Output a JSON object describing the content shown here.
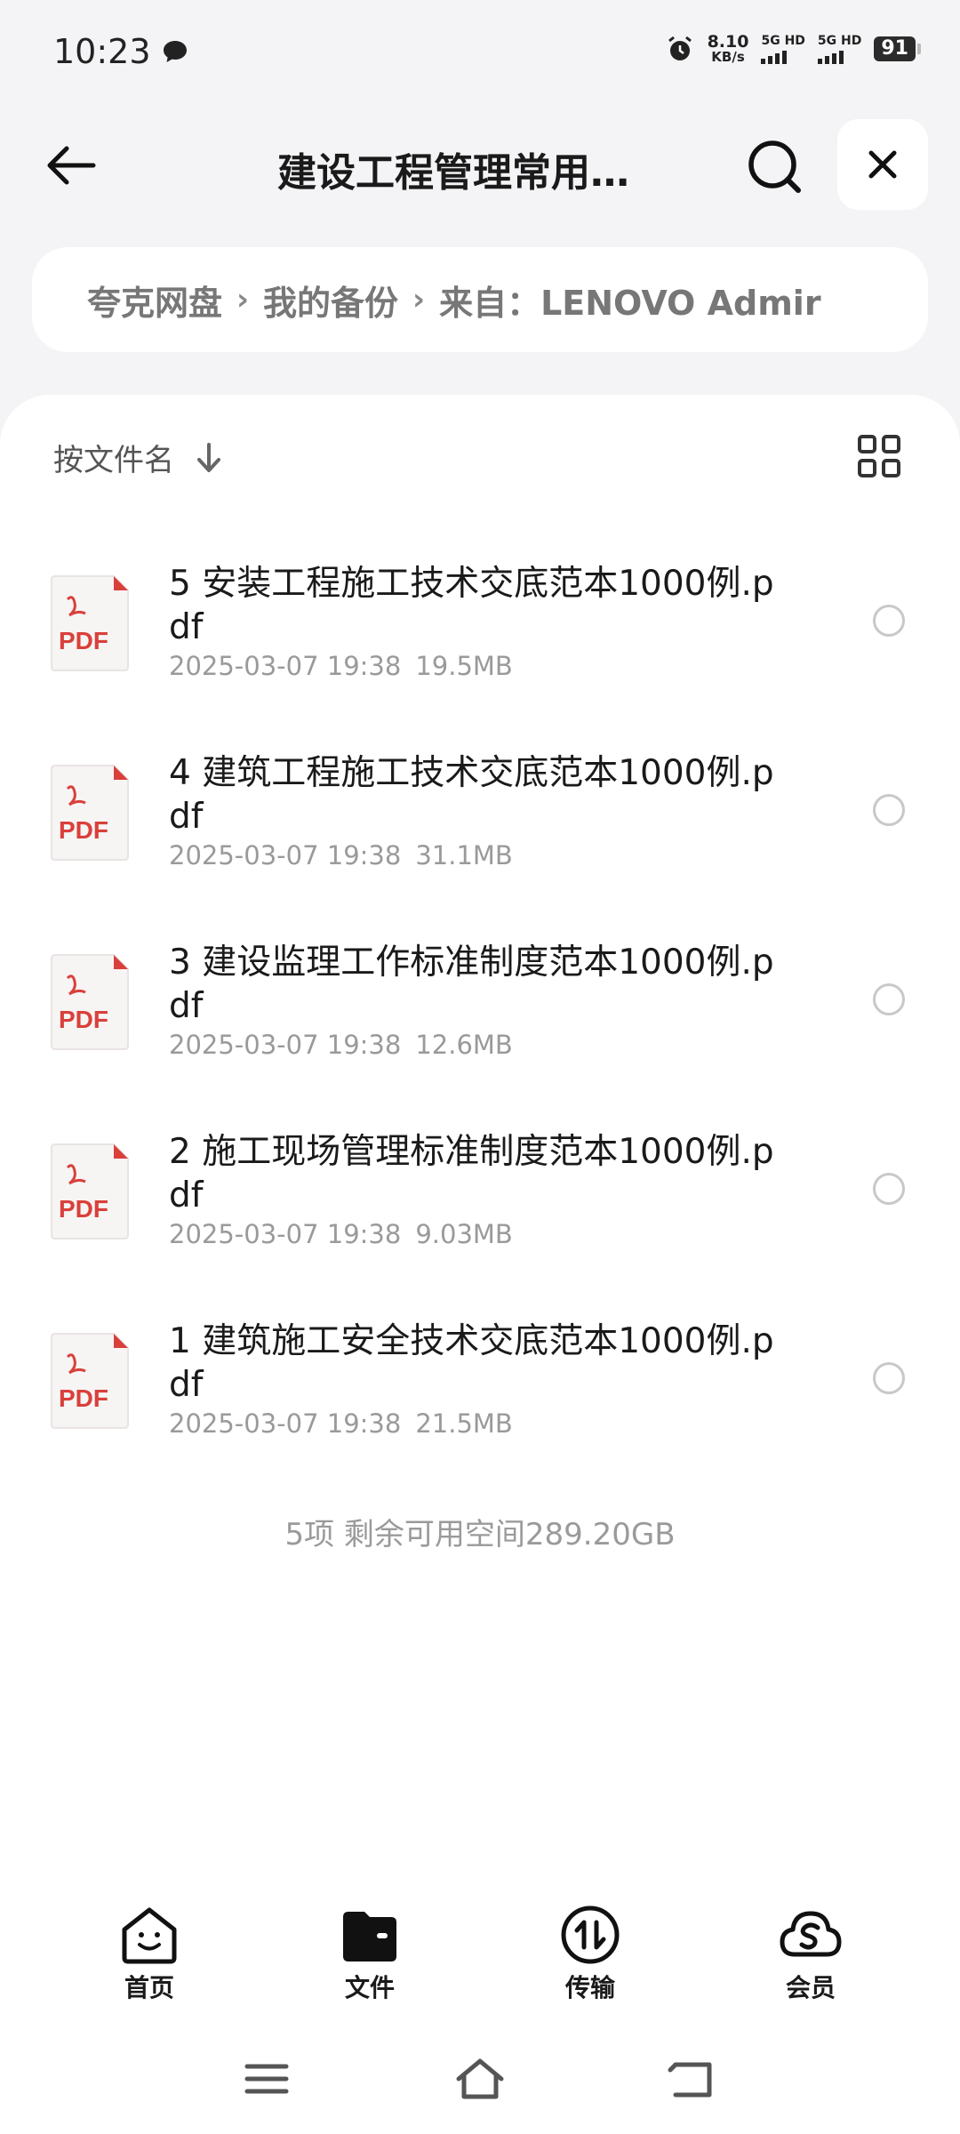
{
  "status_bar": {
    "time": "10:23",
    "net_speed_value": "8.10",
    "net_speed_unit": "KB/s",
    "sim1": "5G HD",
    "sim2": "5G HD",
    "battery": "91"
  },
  "header": {
    "title": "建设工程管理常用…",
    "back_icon": "arrow-left-icon",
    "search_icon": "search-icon",
    "close_icon": "close-icon"
  },
  "breadcrumb": [
    "夸克网盘",
    "我的备份",
    "来自：LENOVO Admir"
  ],
  "breadcrumb_separator": "›",
  "sort": {
    "label": "按文件名"
  },
  "files": [
    {
      "name": "5 安装工程施工技术交底范本1000例.pdf",
      "date": "2025-03-07 19:38",
      "size": "19.5MB"
    },
    {
      "name": "4 建筑工程施工技术交底范本1000例.pdf",
      "date": "2025-03-07 19:38",
      "size": "31.1MB"
    },
    {
      "name": "3 建设监理工作标准制度范本1000例.pdf",
      "date": "2025-03-07 19:38",
      "size": "12.6MB"
    },
    {
      "name": "2 施工现场管理标准制度范本1000例.pdf",
      "date": "2025-03-07 19:38",
      "size": "9.03MB"
    },
    {
      "name": "1 建筑施工安全技术交底范本1000例.pdf",
      "date": "2025-03-07 19:38",
      "size": "21.5MB"
    }
  ],
  "file_icon_label": "PDF",
  "summary": "5项  剩余可用空间289.20GB",
  "bottom_nav": [
    {
      "label": "首页",
      "icon": "home-smile-icon"
    },
    {
      "label": "文件",
      "icon": "folder-icon"
    },
    {
      "label": "传输",
      "icon": "transfer-icon"
    },
    {
      "label": "会员",
      "icon": "cloud-vip-icon"
    }
  ],
  "colors": {
    "pdf_red": "#d9403a",
    "background": "#f4f4f6",
    "card": "#ffffff",
    "muted_text": "#9a9a9a"
  }
}
